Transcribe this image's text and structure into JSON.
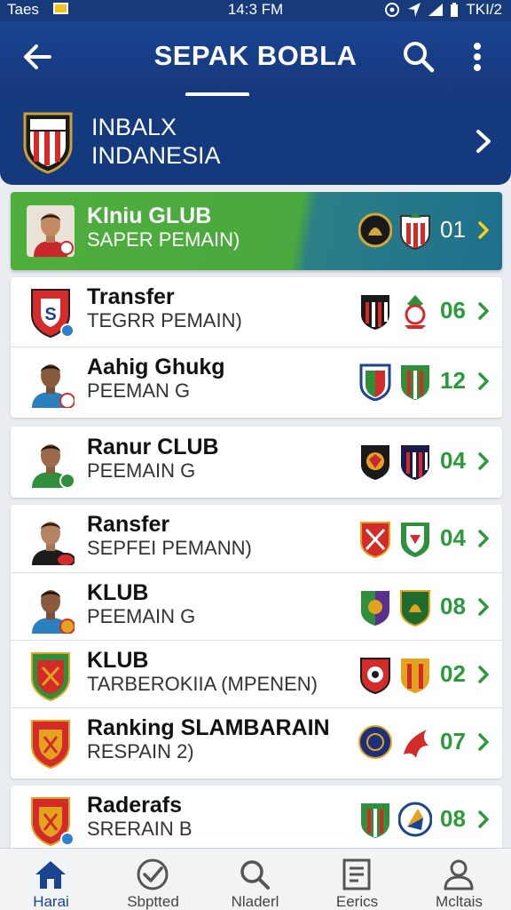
{
  "status_bar": {
    "carrier": "Taes",
    "time": "14:3 FM",
    "right_text": "TKI/2"
  },
  "app_bar": {
    "title": "SEPAK BOBLA"
  },
  "league": {
    "line1": "INBALX",
    "line2": "INDANESIA"
  },
  "featured": {
    "name": "Klniu GLUB",
    "subtitle": "SAPER PEMAIN)",
    "count": "01"
  },
  "rows": [
    {
      "name": "Transfer",
      "subtitle": "TEGRR PEMAIN)",
      "count": "06"
    },
    {
      "name": "Aahig Ghukg",
      "subtitle": "PEEMAN G",
      "count": "12"
    },
    {
      "name": "Ranur CLUB",
      "subtitle": "PEEMAIN G",
      "count": "04"
    },
    {
      "name": "Ransfer",
      "subtitle": "SEPFEI PEMANN)",
      "count": "04"
    },
    {
      "name": "KLUB",
      "subtitle": "PEEMAIN G",
      "count": "08"
    },
    {
      "name": "KLUB",
      "subtitle": "TARBEROKIIA (MPENEN)",
      "count": "02"
    },
    {
      "name": "Ranking SLAMBARAIN",
      "subtitle": "RESPAIN 2)",
      "count": "07"
    },
    {
      "name": "Raderafs",
      "subtitle": "SRERAIN B",
      "count": "08"
    }
  ],
  "bottom_nav": [
    {
      "label": "Harai",
      "icon": "home-icon",
      "active": true
    },
    {
      "label": "Sbptted",
      "icon": "checkmark-circle-icon"
    },
    {
      "label": "Nladerl",
      "icon": "search-icon"
    },
    {
      "label": "Eerics",
      "icon": "document-icon"
    },
    {
      "label": "Mcltais",
      "icon": "person-icon"
    }
  ],
  "colors": {
    "header_blue": "#1a4391",
    "accent_green": "#2b9a3b",
    "featured_green": "#4fae3c"
  }
}
